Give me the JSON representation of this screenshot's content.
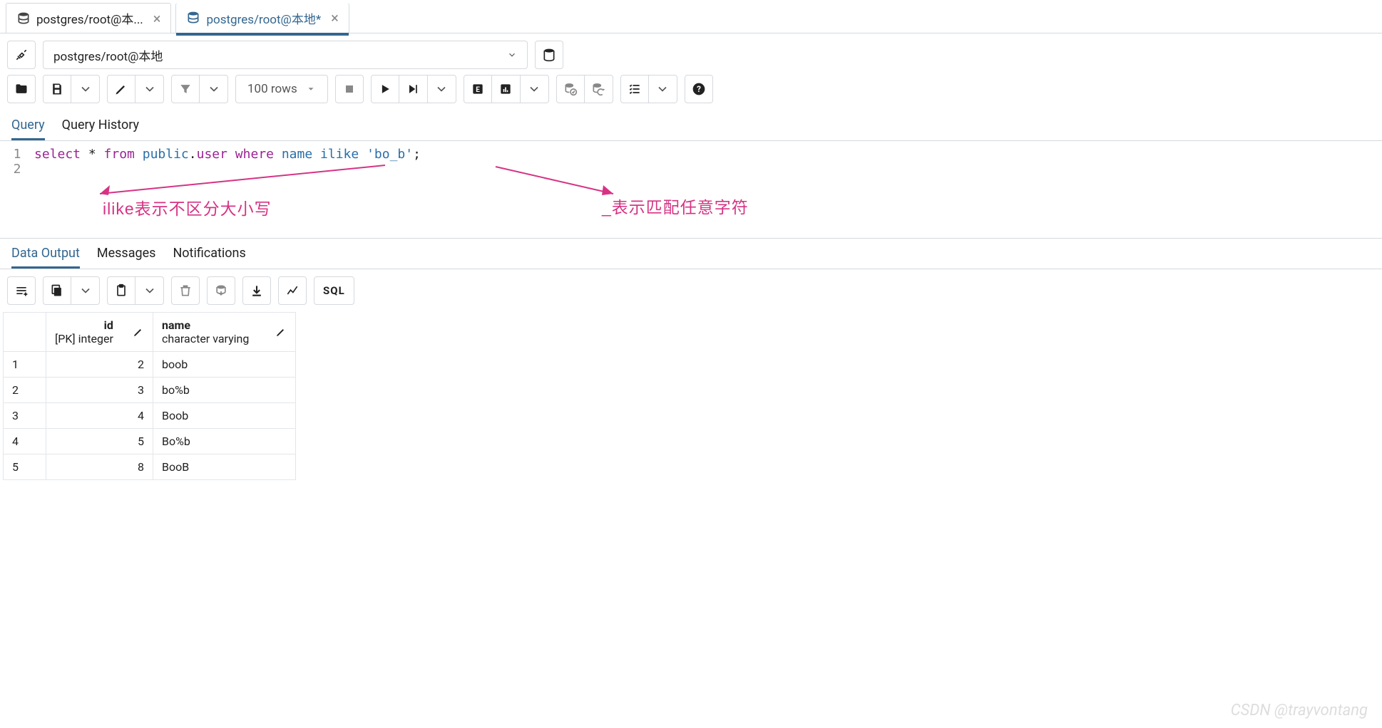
{
  "tabs": [
    {
      "label": "postgres/root@本...",
      "active": false
    },
    {
      "label": "postgres/root@本地*",
      "active": true
    }
  ],
  "connection": {
    "label": "postgres/root@本地"
  },
  "rows_limit": "100 rows",
  "editor_tabs": {
    "query": "Query",
    "history": "Query History"
  },
  "sql": {
    "select": "select",
    "star": " * ",
    "from": "from",
    "schema": " public",
    "dot": ".",
    "table": "user",
    "where": " where",
    "col": " name ",
    "ilike": "ilike",
    "space": " ",
    "literal": "'bo_b'",
    "semi": ";"
  },
  "line_numbers": {
    "l1": "1",
    "l2": "2"
  },
  "annotations": {
    "left": "ilike表示不区分大小写",
    "right": "_表示匹配任意字符"
  },
  "output_tabs": {
    "data": "Data Output",
    "messages": "Messages",
    "notifications": "Notifications"
  },
  "sql_button": "SQL",
  "columns": {
    "id": {
      "name": "id",
      "type": "[PK] integer"
    },
    "name": {
      "name": "name",
      "type": "character varying"
    }
  },
  "rows": [
    {
      "n": "1",
      "id": "2",
      "name": "boob"
    },
    {
      "n": "2",
      "id": "3",
      "name": "bo%b"
    },
    {
      "n": "3",
      "id": "4",
      "name": "Boob"
    },
    {
      "n": "4",
      "id": "5",
      "name": "Bo%b"
    },
    {
      "n": "5",
      "id": "8",
      "name": "BooB"
    }
  ],
  "watermark": "CSDN @trayvontang"
}
